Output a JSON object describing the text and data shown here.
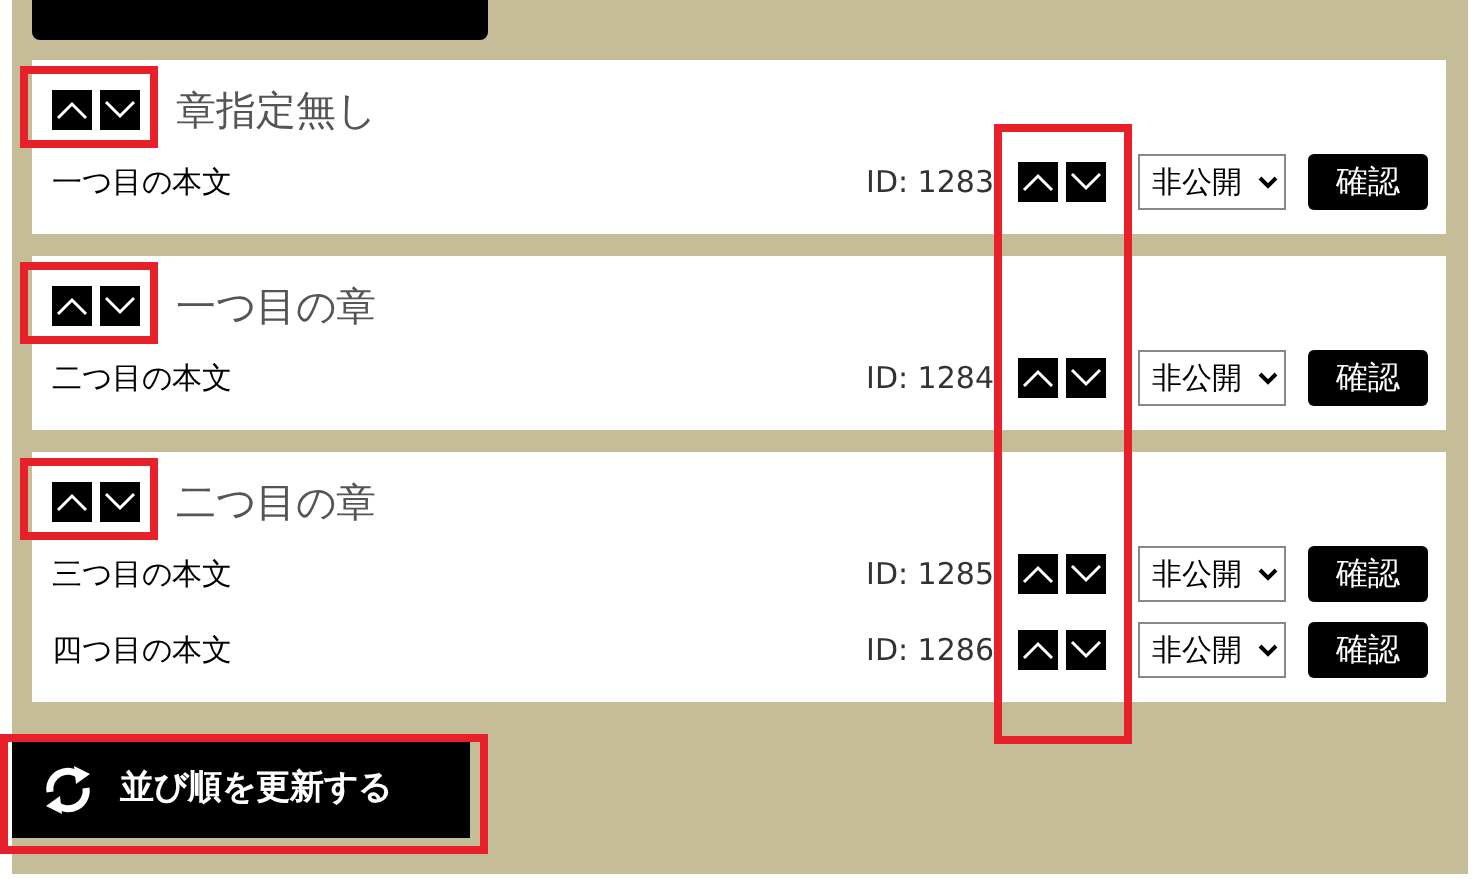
{
  "chapters": [
    {
      "title": "章指定無し",
      "entries": [
        {
          "text": "一つ目の本文",
          "id": "ID: 1283",
          "visibility": "非公開",
          "confirm": "確認"
        }
      ]
    },
    {
      "title": "一つ目の章",
      "entries": [
        {
          "text": "二つ目の本文",
          "id": "ID: 1284",
          "visibility": "非公開",
          "confirm": "確認"
        }
      ]
    },
    {
      "title": "二つ目の章",
      "entries": [
        {
          "text": "三つ目の本文",
          "id": "ID: 1285",
          "visibility": "非公開",
          "confirm": "確認"
        },
        {
          "text": "四つ目の本文",
          "id": "ID: 1286",
          "visibility": "非公開",
          "confirm": "確認"
        }
      ]
    }
  ],
  "update_button": {
    "label": "並び順を更新する"
  }
}
